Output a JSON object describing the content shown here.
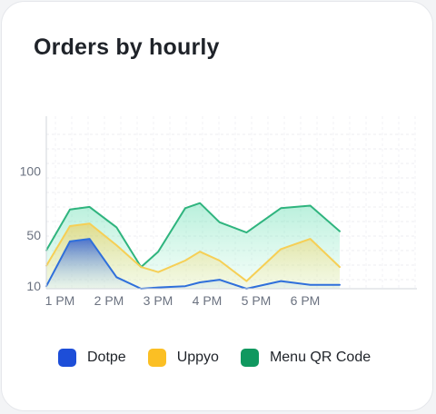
{
  "card": {
    "title": "Orders by hourly"
  },
  "chart_data": {
    "type": "area",
    "title": "Orders by hourly",
    "xlabel": "",
    "ylabel": "",
    "x_ticks": [
      "1 PM",
      "2 PM",
      "3 PM",
      "4 PM",
      "5 PM",
      "6 PM"
    ],
    "y_ticks": [
      10,
      50,
      100
    ],
    "x": [
      1.0,
      1.5,
      1.9,
      2.45,
      2.95,
      3.3,
      3.85,
      4.15,
      4.55,
      5.1,
      5.8,
      6.4,
      7.0
    ],
    "xlim": [
      1,
      7.0
    ],
    "ylim": [
      8,
      143
    ],
    "grid": true,
    "legend_position": "bottom",
    "series": [
      {
        "name": "Dotpe",
        "color": "#1d4ed8",
        "values": [
          10,
          45,
          47,
          17,
          8,
          9,
          10,
          13,
          15,
          8,
          14,
          11,
          11
        ]
      },
      {
        "name": "Uppyo",
        "color": "#fbbf24",
        "values": [
          26,
          57,
          59,
          42,
          25,
          21,
          30,
          37,
          30,
          14,
          39,
          47,
          25
        ]
      },
      {
        "name": "Menu QR Code",
        "color": "#10b981",
        "values": [
          38,
          70,
          72,
          56,
          25,
          37,
          71,
          75,
          60,
          52,
          71,
          73,
          53
        ]
      }
    ]
  },
  "legend": [
    {
      "label": "Dotpe",
      "color": "#1d4ed8"
    },
    {
      "label": "Uppyo",
      "color": "#fbbf24"
    },
    {
      "label": "Menu QR Code",
      "color": "#10b981"
    }
  ]
}
